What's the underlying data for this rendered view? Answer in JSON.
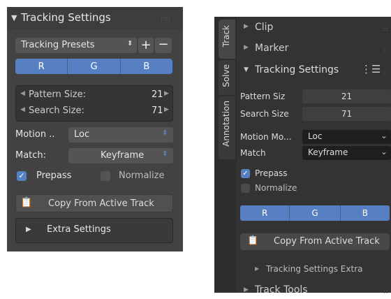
{
  "left": {
    "title": "Tracking Settings",
    "presets_label": "Tracking Presets",
    "add_symbol": "+",
    "remove_symbol": "−",
    "channels": [
      "R",
      "G",
      "B"
    ],
    "pattern_size_label": "Pattern Size:",
    "pattern_size_value": "21",
    "search_size_label": "Search Size:",
    "search_size_value": "71",
    "motion_label": "Motion ..",
    "motion_value": "Loc",
    "match_label": "Match:",
    "match_value": "Keyframe",
    "prepass_label": "Prepass",
    "prepass_checked": true,
    "normalize_label": "Normalize",
    "normalize_checked": false,
    "copy_label": "Copy From Active Track",
    "extra_label": "Extra Settings"
  },
  "right": {
    "tabs": [
      "Track",
      "Solve",
      "Annotation"
    ],
    "active_tab": "Track",
    "clip_label": "Clip",
    "marker_label": "Marker",
    "tracking_settings_label": "Tracking Settings",
    "pattern_size_label": "Pattern Siz",
    "pattern_size_value": "21",
    "search_size_label": "Search Size",
    "search_size_value": "71",
    "motion_label": "Motion Mo...",
    "motion_value": "Loc",
    "match_label": "Match",
    "match_value": "Keyframe",
    "prepass_label": "Prepass",
    "prepass_checked": true,
    "normalize_label": "Normalize",
    "normalize_checked": false,
    "channels": [
      "R",
      "G",
      "B"
    ],
    "copy_label": "Copy From Active Track",
    "extra_label": "Tracking Settings Extra",
    "track_tools_label": "Track Tools"
  },
  "colors": {
    "accent": "#5680c2",
    "left_panel_bg": "#424242",
    "right_panel_bg": "#2e2e2e"
  }
}
